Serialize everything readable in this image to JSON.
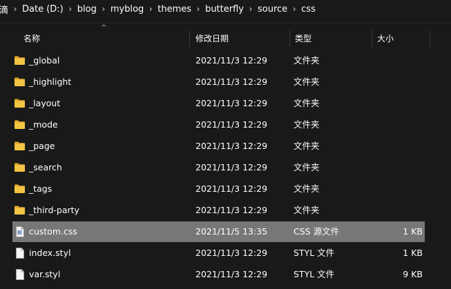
{
  "breadcrumb": {
    "lead": "滴",
    "items": [
      "Date (D:)",
      "blog",
      "myblog",
      "themes",
      "butterfly",
      "source",
      "css"
    ],
    "separator": "›"
  },
  "columns": {
    "name": "名称",
    "date": "修改日期",
    "type": "类型",
    "size": "大小"
  },
  "sort_indicator": "^",
  "files": [
    {
      "name": "_global",
      "date": "2021/11/3 12:29",
      "type": "文件夹",
      "size": "",
      "kind": "folder-icon",
      "selected": false
    },
    {
      "name": "_highlight",
      "date": "2021/11/3 12:29",
      "type": "文件夹",
      "size": "",
      "kind": "folder-icon",
      "selected": false
    },
    {
      "name": "_layout",
      "date": "2021/11/3 12:29",
      "type": "文件夹",
      "size": "",
      "kind": "folder-icon",
      "selected": false
    },
    {
      "name": "_mode",
      "date": "2021/11/3 12:29",
      "type": "文件夹",
      "size": "",
      "kind": "folder-icon",
      "selected": false
    },
    {
      "name": "_page",
      "date": "2021/11/3 12:29",
      "type": "文件夹",
      "size": "",
      "kind": "folder-icon",
      "selected": false
    },
    {
      "name": "_search",
      "date": "2021/11/3 12:29",
      "type": "文件夹",
      "size": "",
      "kind": "folder-icon",
      "selected": false
    },
    {
      "name": "_tags",
      "date": "2021/11/3 12:29",
      "type": "文件夹",
      "size": "",
      "kind": "folder-icon",
      "selected": false
    },
    {
      "name": "_third-party",
      "date": "2021/11/3 12:29",
      "type": "文件夹",
      "size": "",
      "kind": "folder-icon",
      "selected": false
    },
    {
      "name": "custom.css",
      "date": "2021/11/5 13:35",
      "type": "CSS 源文件",
      "size": "1 KB",
      "kind": "css-file-icon",
      "selected": true
    },
    {
      "name": "index.styl",
      "date": "2021/11/3 12:29",
      "type": "STYL 文件",
      "size": "1 KB",
      "kind": "file-icon",
      "selected": false
    },
    {
      "name": "var.styl",
      "date": "2021/11/3 12:29",
      "type": "STYL 文件",
      "size": "9 KB",
      "kind": "file-icon",
      "selected": false
    }
  ],
  "colors": {
    "background": "#191919",
    "selected_row": "#777777",
    "folder": "#f4c443",
    "folder_dark": "#e0a82e",
    "text": "#ffffff"
  }
}
